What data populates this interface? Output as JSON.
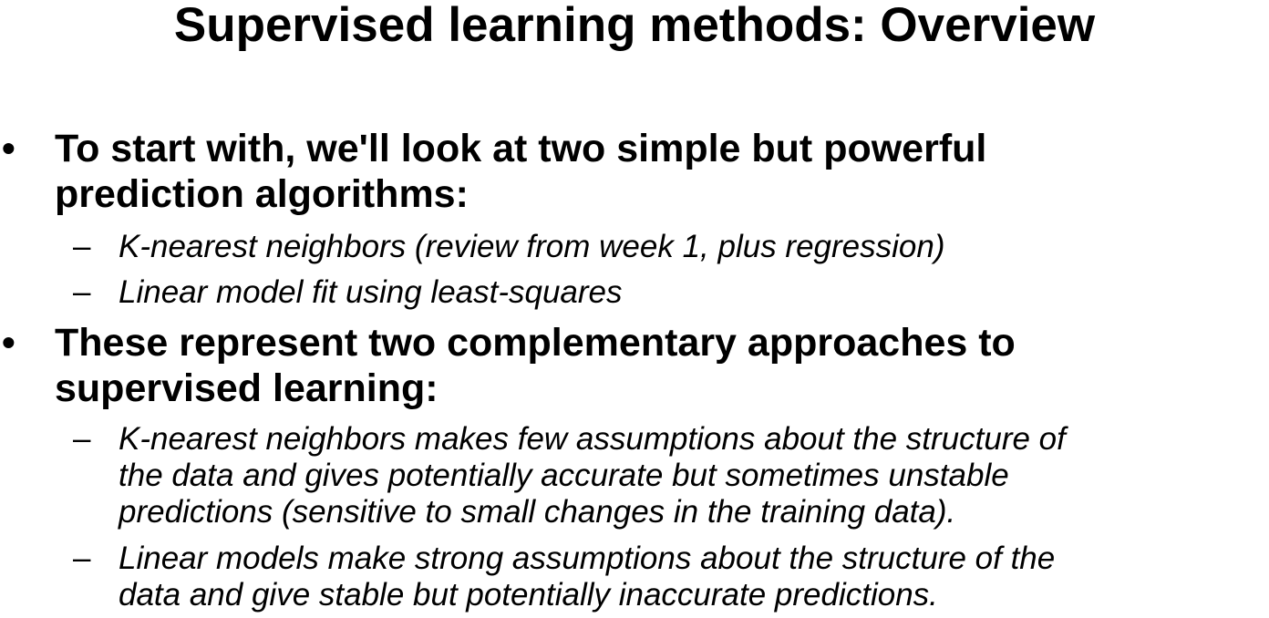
{
  "slide": {
    "title": "Supervised learning methods: Overview",
    "bullets": [
      {
        "mark": "•",
        "lines": [
          "To start with, we'll look at two simple but powerful",
          "prediction algorithms:"
        ],
        "subitems": [
          {
            "mark": "–",
            "lines": [
              "K-nearest neighbors (review from week 1, plus regression)"
            ]
          },
          {
            "mark": "–",
            "lines": [
              "Linear model fit using least-squares"
            ]
          }
        ]
      },
      {
        "mark": "•",
        "lines": [
          "These represent two complementary approaches to",
          "supervised learning:"
        ],
        "subitems": [
          {
            "mark": "–",
            "lines": [
              "K-nearest neighbors makes few assumptions about the structure of",
              "the data and gives potentially accurate but sometimes unstable",
              "predictions (sensitive to small changes in the training data)."
            ]
          },
          {
            "mark": "–",
            "lines": [
              "Linear models make strong assumptions about the structure of the",
              "data and give stable but potentially inaccurate predictions."
            ]
          }
        ]
      }
    ]
  }
}
